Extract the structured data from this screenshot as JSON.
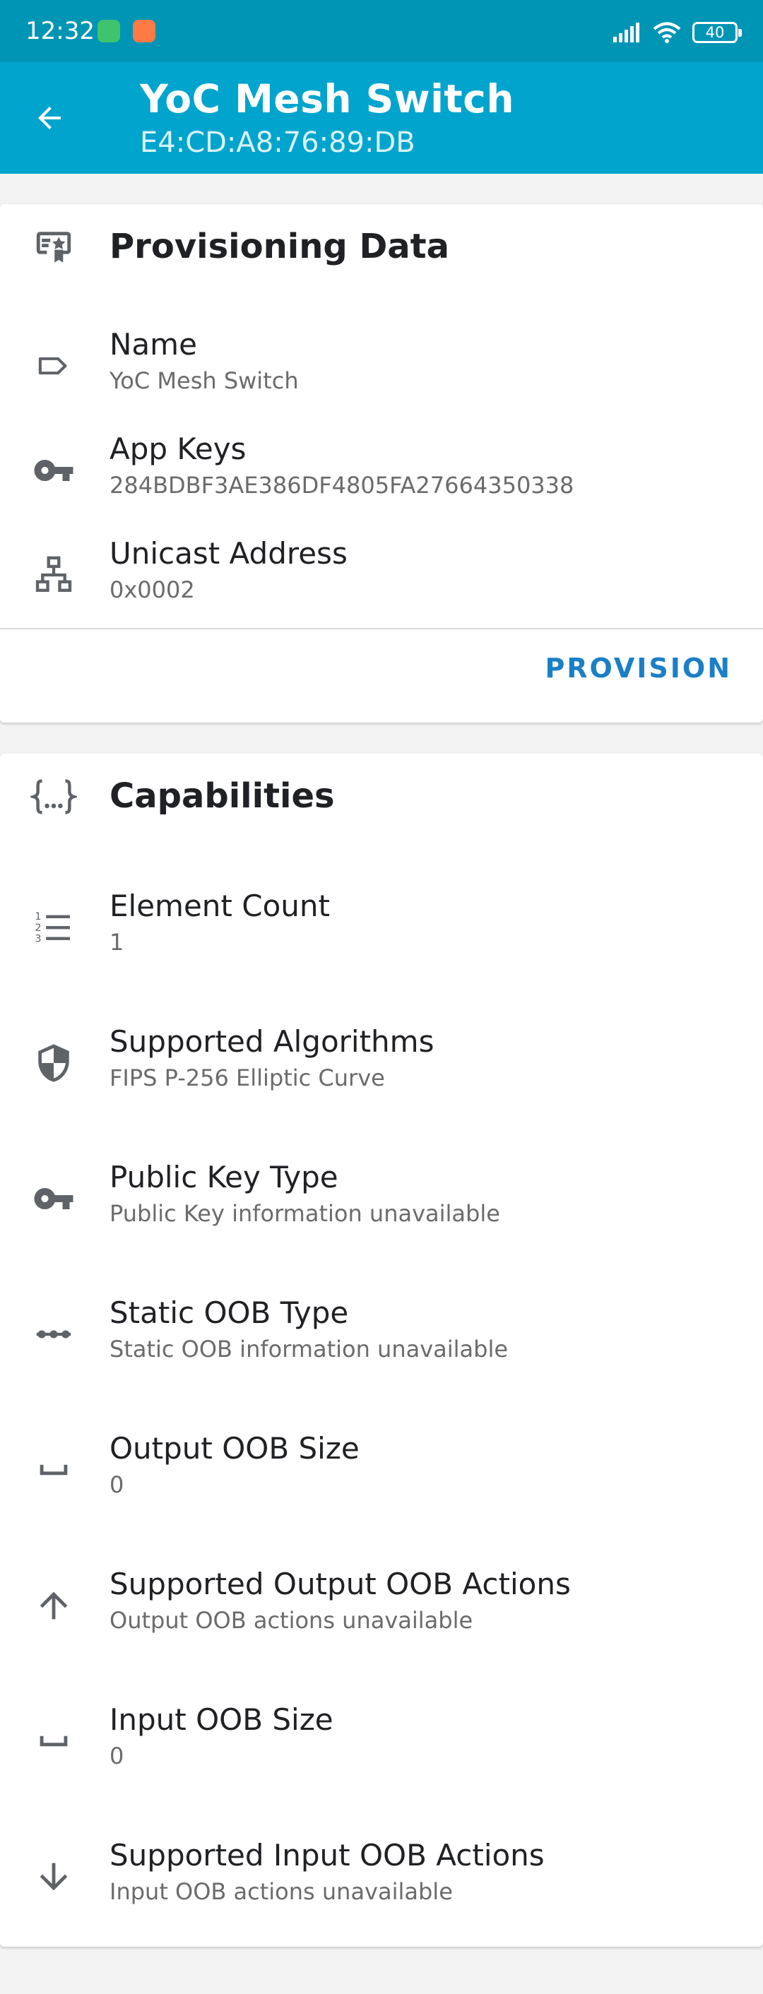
{
  "status_bar": {
    "time": "12:32",
    "battery": "40"
  },
  "app_bar": {
    "title": "YoC Mesh Switch",
    "subtitle": "E4:CD:A8:76:89:DB"
  },
  "provisioning": {
    "title": "Provisioning Data",
    "rows": [
      {
        "label": "Name",
        "value": "YoC Mesh Switch",
        "icon": "label-icon"
      },
      {
        "label": "App Keys",
        "value": "284BDBF3AE386DF4805FA27664350338",
        "icon": "key-icon"
      },
      {
        "label": "Unicast Address",
        "value": "0x0002",
        "icon": "network-icon"
      }
    ],
    "action_label": "PROVISION"
  },
  "capabilities": {
    "title": "Capabilities",
    "rows": [
      {
        "label": "Element Count",
        "value": "1",
        "icon": "numbered-list-icon"
      },
      {
        "label": "Supported Algorithms",
        "value": "FIPS P-256 Elliptic Curve",
        "icon": "shield-icon"
      },
      {
        "label": "Public Key Type",
        "value": "Public Key information unavailable",
        "icon": "key-icon"
      },
      {
        "label": "Static OOB Type",
        "value": "Static OOB information unavailable",
        "icon": "dots-line-icon"
      },
      {
        "label": "Output OOB Size",
        "value": "0",
        "icon": "space-bar-icon"
      },
      {
        "label": "Supported Output OOB Actions",
        "value": "Output OOB actions unavailable",
        "icon": "arrow-up-icon"
      },
      {
        "label": "Input OOB Size",
        "value": "0",
        "icon": "space-bar-icon"
      },
      {
        "label": "Supported Input OOB Actions",
        "value": "Input OOB actions unavailable",
        "icon": "arrow-down-icon"
      }
    ]
  },
  "colors": {
    "status_bar": "#0095b5",
    "app_bar": "#00a4cd",
    "accent": "#1a7fc7",
    "icon": "#5f6368"
  }
}
